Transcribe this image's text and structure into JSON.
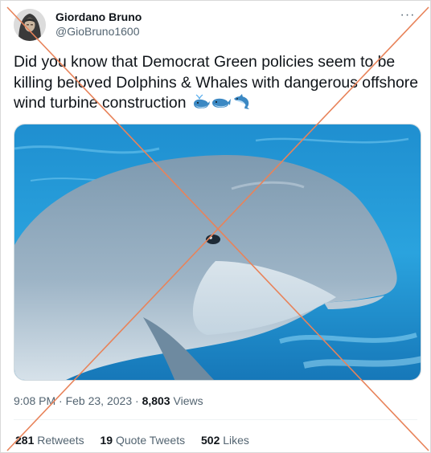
{
  "author": {
    "display_name": "Giordano Bruno",
    "handle": "@GioBruno1600"
  },
  "header": {
    "more_label": "···"
  },
  "tweet": {
    "text": "Did you know that Democrat Green policies seem to be killing beloved Dolphins & Whales with dangerous offshore wind turbine construction",
    "emojis": [
      "spouting-whale-icon",
      "whale-icon",
      "dolphin-icon"
    ]
  },
  "meta": {
    "time": "9:08 PM",
    "separator": "·",
    "date": "Feb 23, 2023",
    "views_count": "8,803",
    "views_label": "Views"
  },
  "stats": {
    "retweets_count": "281",
    "retweets_label": "Retweets",
    "quotes_count": "19",
    "quotes_label": "Quote Tweets",
    "likes_count": "502",
    "likes_label": "Likes"
  },
  "colors": {
    "text_primary": "#0f1419",
    "text_secondary": "#536471",
    "cross_line": "#e8835a",
    "water": "#2a9fd8",
    "dolphin": "#8fa9bd"
  }
}
